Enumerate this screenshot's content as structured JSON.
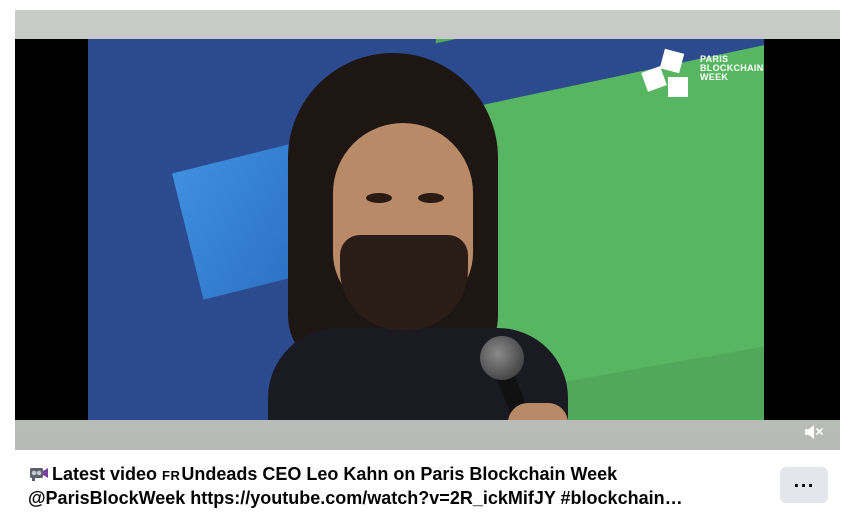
{
  "video": {
    "logo": {
      "line1": "PARIS",
      "line2": "BLOCKCHAIN",
      "line3": "WEEK"
    },
    "mute_icon": "speaker-muted-icon"
  },
  "post": {
    "camera_icon": "video-camera-icon",
    "region_badge": "FR",
    "line1_text": "Latest video ",
    "line1_rest": "Undeads CEO Leo Kahn on Paris Blockchain Week",
    "line2_text": "@ParisBlockWeek https://youtube.com/watch?v=2R_ickMifJY #blockchain…",
    "more_label": "···"
  },
  "colors": {
    "scene_green": "#52a85a",
    "scene_blue": "#2c4b8f",
    "more_button_bg": "#e4e6eb"
  }
}
